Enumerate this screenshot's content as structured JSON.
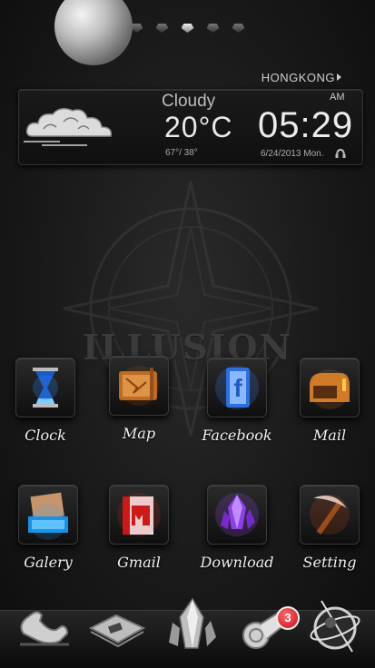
{
  "pager": {
    "pages": 5,
    "active_index": 2
  },
  "weather": {
    "city": "HONGKONG",
    "condition": "Cloudy",
    "temperature": "20°C",
    "range": "67°/ 38°"
  },
  "clock": {
    "ampm": "AM",
    "time": "05:29",
    "date": "6/24/2013 Mon."
  },
  "wallpaper": {
    "watermark": "ILLUSION"
  },
  "apps": [
    {
      "label": "Clock",
      "icon": "hourglass-icon"
    },
    {
      "label": "Map",
      "icon": "scroll-map-icon"
    },
    {
      "label": "Facebook",
      "icon": "facebook-icon"
    },
    {
      "label": "Mail",
      "icon": "mailbox-icon"
    },
    {
      "label": "Galery",
      "icon": "gallery-icon"
    },
    {
      "label": "Gmail",
      "icon": "gmail-book-icon"
    },
    {
      "label": "Download",
      "icon": "crystal-icon"
    },
    {
      "label": "Setting",
      "icon": "pickaxe-icon"
    }
  ],
  "dock": {
    "items": [
      "phone-icon",
      "messages-icon",
      "app-drawer-crystal-icon",
      "scroll-icon",
      "browser-globe-icon"
    ],
    "badge_count": "3"
  },
  "colors": {
    "background": "#1c1c1c",
    "badge": "#c0101a",
    "text": "#f0f0f0"
  }
}
